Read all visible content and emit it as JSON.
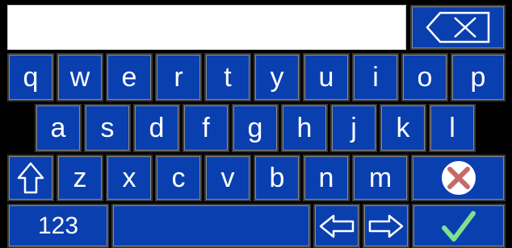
{
  "input": {
    "value": ""
  },
  "keyboard": {
    "row1": [
      "q",
      "w",
      "e",
      "r",
      "t",
      "y",
      "u",
      "i",
      "o",
      "p"
    ],
    "row2": [
      "a",
      "s",
      "d",
      "f",
      "g",
      "h",
      "j",
      "k",
      "l"
    ],
    "row3": [
      "z",
      "x",
      "c",
      "v",
      "b",
      "n",
      "m"
    ],
    "numbers_key": "123",
    "icons": {
      "backspace": "backspace-icon",
      "shift": "shift-icon",
      "cancel": "cancel-icon",
      "left": "left-arrow-icon",
      "right": "right-arrow-icon",
      "confirm": "checkmark-icon"
    }
  },
  "colors": {
    "key_bg": "#0a3fb0",
    "cancel_x": "#c46a6a",
    "confirm_check": "#7fe08d"
  }
}
